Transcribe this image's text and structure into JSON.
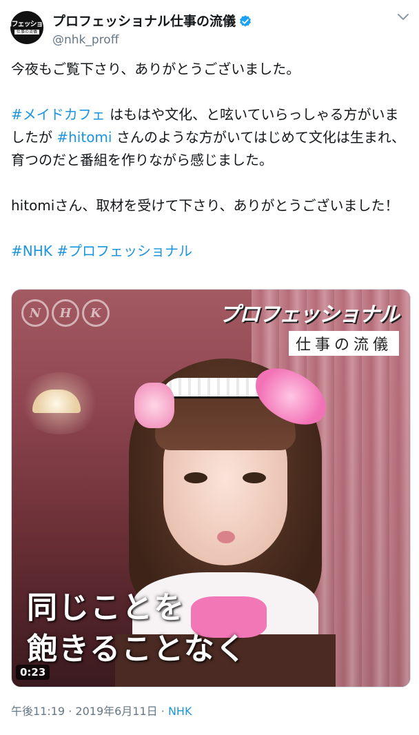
{
  "user": {
    "display_name": "プロフェッショナル仕事の流儀",
    "handle": "@nhk_proff",
    "verified": true,
    "avatar_text_top": "プロフェッショナル",
    "avatar_text_bottom": "仕事の流儀",
    "verified_icon": "verified-badge-icon",
    "menu_icon": "chevron-down-icon"
  },
  "tweet": {
    "line1": "今夜もご覧下さり、ありがとうございました。",
    "p2_hashtag1": "#メイドカフェ",
    "p2_text1": " はもはや文化、と呟いていらっしゃる方がいましたが ",
    "p2_hashtag2": "#hitomi",
    "p2_text2": " さんのような方がいてはじめて文化は生まれ、育つのだと番組を作りながら感じました。",
    "p3": "hitomiさん、取材を受けて下さり、ありがとうございました！",
    "tag_nhk": "#NHK",
    "tag_pro": "#プロフェッショナル"
  },
  "media": {
    "broadcaster_logo": [
      "N",
      "H",
      "K"
    ],
    "program_title": "プロフェッショナル",
    "program_subtitle": "仕事の流儀",
    "caption_line1": "同じことを",
    "caption_line2": "飽きることなく",
    "duration": "0:23"
  },
  "meta": {
    "time": "午後11:19",
    "separator": "·",
    "date": "2019年6月11日",
    "source": "NHK"
  },
  "colors": {
    "link": "#1b95e0",
    "text": "#14171a",
    "secondary": "#657786"
  }
}
